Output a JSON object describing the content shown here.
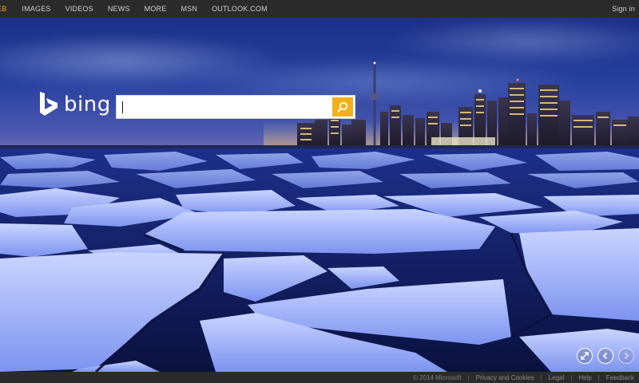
{
  "nav": {
    "items": [
      {
        "label": "EB",
        "active": true
      },
      {
        "label": "IMAGES"
      },
      {
        "label": "VIDEOS"
      },
      {
        "label": "NEWS"
      },
      {
        "label": "MORE"
      },
      {
        "label": "MSN"
      },
      {
        "label": "OUTLOOK.COM"
      }
    ],
    "signin": "Sign in"
  },
  "logo": {
    "wordmark": "bing"
  },
  "search": {
    "value": "",
    "button_icon": "search-icon"
  },
  "controls": {
    "icons": [
      "expand-icon",
      "previous-icon",
      "next-icon"
    ]
  },
  "footer": {
    "copyright": "© 2014 Microsoft",
    "links": [
      "Privacy and Cookies",
      "Legal",
      "Help",
      "Feedback"
    ],
    "separator": "|"
  },
  "colors": {
    "accent": "#f2b11a",
    "active_nav": "#f0a01e",
    "bar_bg": "#2b2b2b"
  }
}
